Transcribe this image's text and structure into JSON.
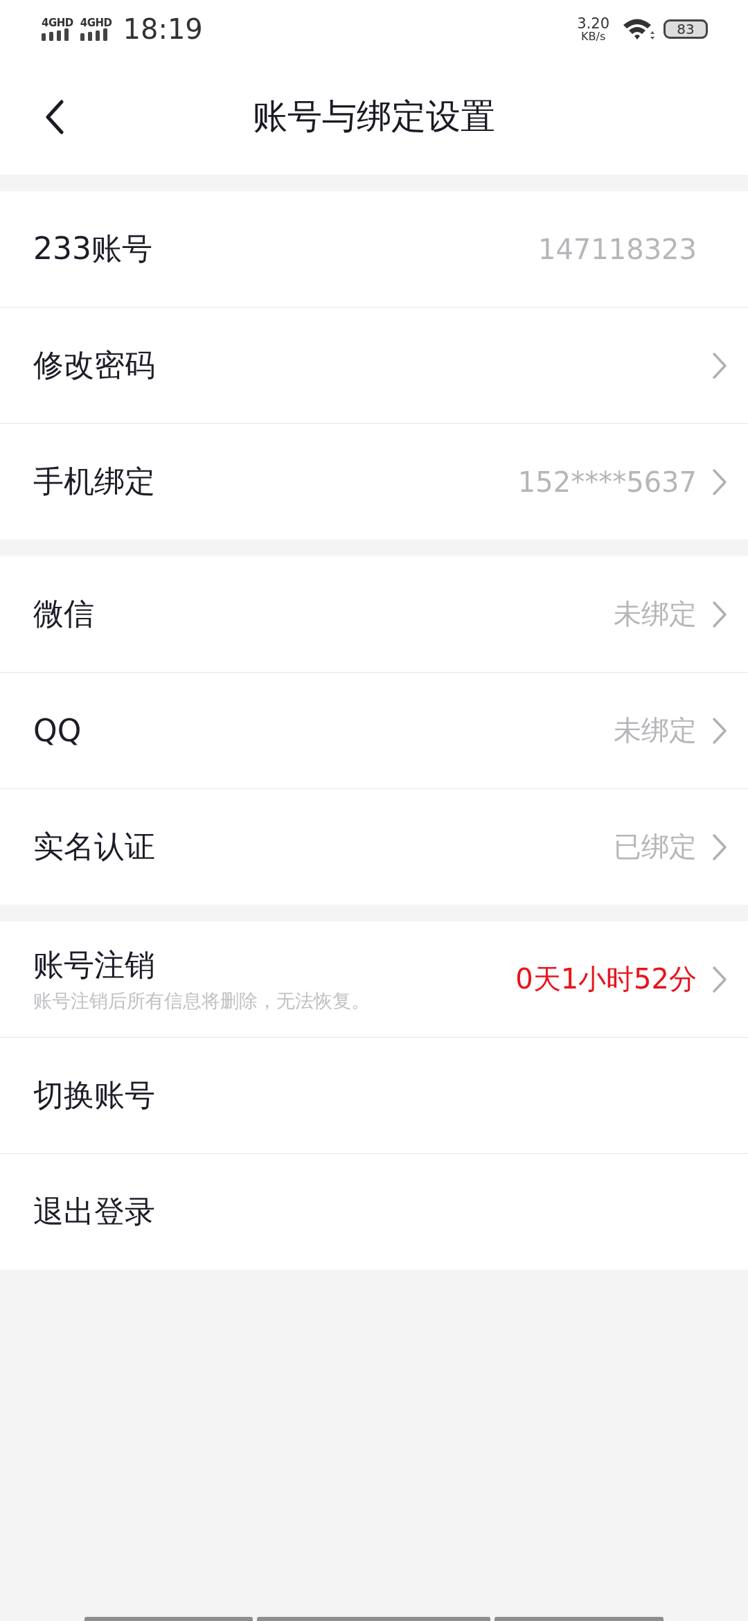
{
  "status_bar": {
    "signals": [
      "4GHD",
      "4GHD"
    ],
    "time": "18:19",
    "net_speed": "3.20",
    "net_unit": "KB/s",
    "battery": "83"
  },
  "header": {
    "title": "账号与绑定设置"
  },
  "groups": [
    {
      "rows": [
        {
          "label": "233账号",
          "value": "147118323",
          "kind": "normal",
          "chevron": false
        },
        {
          "label": "修改密码",
          "kind": "normal",
          "chevron": true
        },
        {
          "label": "手机绑定",
          "value": "152****5637",
          "kind": "normal",
          "chevron": true
        }
      ]
    },
    {
      "rows": [
        {
          "label": "微信",
          "value": "未绑定",
          "kind": "normal",
          "chevron": true
        },
        {
          "label": "QQ",
          "value": "未绑定",
          "kind": "normal",
          "chevron": true
        },
        {
          "label": "实名认证",
          "value": "已绑定",
          "kind": "normal",
          "chevron": true
        }
      ]
    },
    {
      "rows": [
        {
          "label": "账号注销",
          "subtitle": "账号注销后所有信息将删除，无法恢复。",
          "value": "0天1小时52分",
          "kind": "alert",
          "chevron": true
        },
        {
          "label": "切换账号",
          "kind": "normal",
          "chevron": false
        },
        {
          "label": "退出登录",
          "kind": "normal",
          "chevron": false
        }
      ]
    }
  ]
}
